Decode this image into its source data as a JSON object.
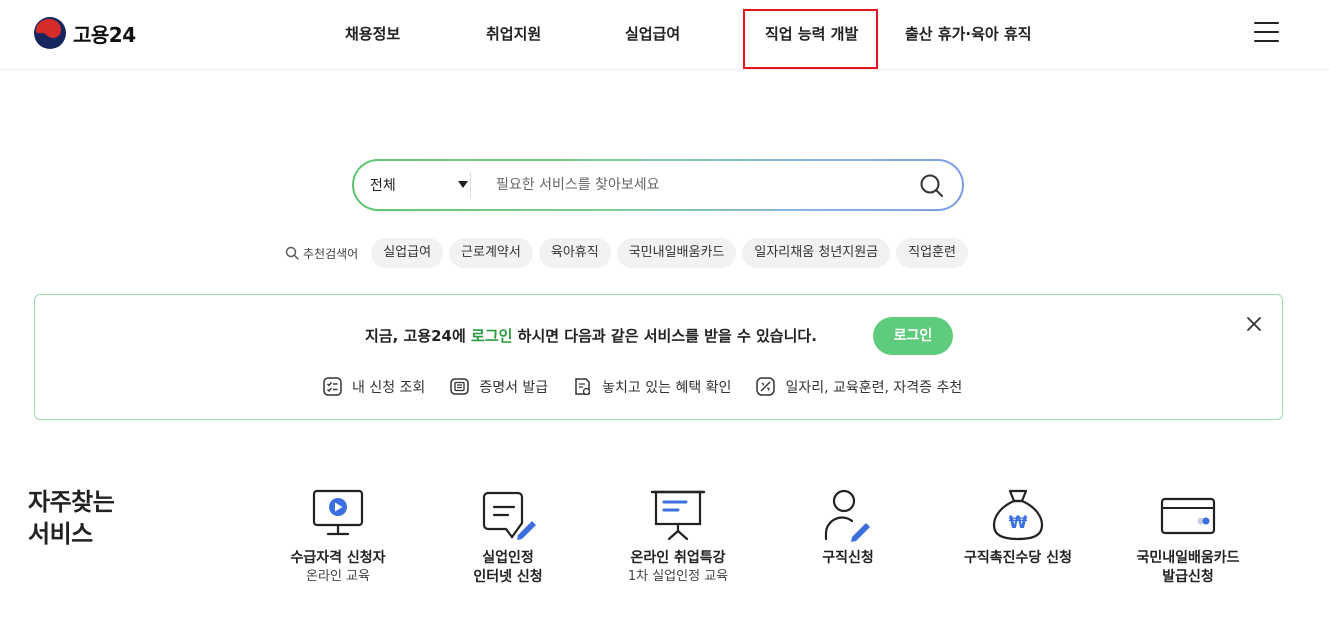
{
  "brand": {
    "name": "고용24",
    "accent": "#5fcc7d",
    "highlight_border": "#e8141b"
  },
  "nav": {
    "items": [
      {
        "label": "채용정보"
      },
      {
        "label": "취업지원"
      },
      {
        "label": "실업급여"
      },
      {
        "label": "직업 능력 개발"
      },
      {
        "label": "출산 휴가·육아 휴직"
      }
    ],
    "menu_icon": "hamburger-menu-icon"
  },
  "search": {
    "category": "전체",
    "placeholder": "필요한 서비스를 찾아보세요",
    "button_icon": "search-icon"
  },
  "recommended": {
    "label": "추천검색어",
    "keywords": [
      "실업급여",
      "근로계약서",
      "육아휴직",
      "국민내일배움카드",
      "일자리채움 청년지원금",
      "직업훈련"
    ]
  },
  "banner": {
    "message_prefix": "지금, 고용24에 ",
    "message_link": "로그인",
    "message_suffix": " 하시면 다음과 같은 서비스를 받을 수 있습니다.",
    "login_button": "로그인",
    "close_icon": "close-icon",
    "links": [
      {
        "label": "내 신청 조회",
        "icon": "checklist-icon"
      },
      {
        "label": "증명서 발급",
        "icon": "certificate-icon"
      },
      {
        "label": "놓치고 있는 혜택 확인",
        "icon": "benefit-document-icon"
      },
      {
        "label": "일자리, 교육훈련, 자격증 추천",
        "icon": "recommend-icon"
      }
    ]
  },
  "services": {
    "title_line1": "자주찾는",
    "title_line2": "서비스",
    "items": [
      {
        "line1": "수급자격 신청자",
        "line2": "온라인 교육",
        "icon": "video-monitor-icon"
      },
      {
        "line1": "실업인정",
        "line2": "인터넷 신청",
        "icon": "document-pen-icon"
      },
      {
        "line1": "온라인 취업특강",
        "line2": "1차 실업인정 교육",
        "icon": "presentation-board-icon"
      },
      {
        "line1": "구직신청",
        "line2": "",
        "icon": "person-pen-icon"
      },
      {
        "line1": "구직촉진수당 신청",
        "line2": "",
        "icon": "money-bag-icon"
      },
      {
        "line1": "국민내일배움카드",
        "line2": "발급신청",
        "icon": "card-icon"
      }
    ]
  }
}
